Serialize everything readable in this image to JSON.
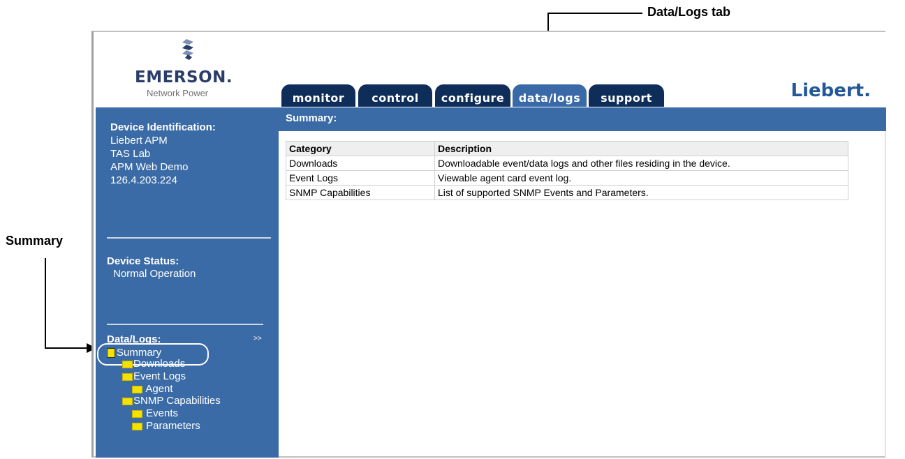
{
  "callouts": {
    "datalogs_tab": "Data/Logs tab",
    "summary": "Summary"
  },
  "header": {
    "brand": "EMERSON.",
    "brand_sub": "Network Power",
    "right_logo": "Liebert."
  },
  "tabs": [
    {
      "label": "monitor",
      "active": false
    },
    {
      "label": "control",
      "active": false
    },
    {
      "label": "configure",
      "active": false
    },
    {
      "label": "data/logs",
      "active": true
    },
    {
      "label": "support",
      "active": false
    }
  ],
  "sidebar": {
    "device_identification": {
      "heading": "Device Identification:",
      "lines": [
        "Liebert APM",
        "TAS Lab",
        "APM Web Demo",
        "126.4.203.224"
      ]
    },
    "device_status": {
      "heading": "Device Status:",
      "value": "Normal Operation"
    },
    "datalogs": {
      "heading": "Data/Logs:",
      "expand": ">>",
      "tree": [
        {
          "label": "Summary",
          "icon": "page-icon"
        },
        {
          "label": "Downloads",
          "icon": "folder-icon"
        },
        {
          "label": "Event Logs",
          "icon": "folder-icon"
        },
        {
          "label": "Agent",
          "icon": "folder-icon"
        },
        {
          "label": "SNMP Capabilities",
          "icon": "folder-icon"
        },
        {
          "label": "Events",
          "icon": "folder-icon"
        },
        {
          "label": "Parameters",
          "icon": "folder-icon"
        }
      ]
    }
  },
  "main": {
    "title": "Summary:",
    "table": {
      "headers": [
        "Category",
        "Description"
      ],
      "rows": [
        [
          "Downloads",
          "Downloadable event/data logs and other files residing in the device."
        ],
        [
          "Event Logs",
          "Viewable agent card event log."
        ],
        [
          "SNMP Capabilities",
          "List of supported SNMP Events and Parameters."
        ]
      ]
    }
  },
  "colors": {
    "sidebar_bg": "#3b6ba7",
    "tab_bg": "#0f2d59",
    "tab_active_bg": "#3969a6",
    "folder": "#f3e100"
  }
}
